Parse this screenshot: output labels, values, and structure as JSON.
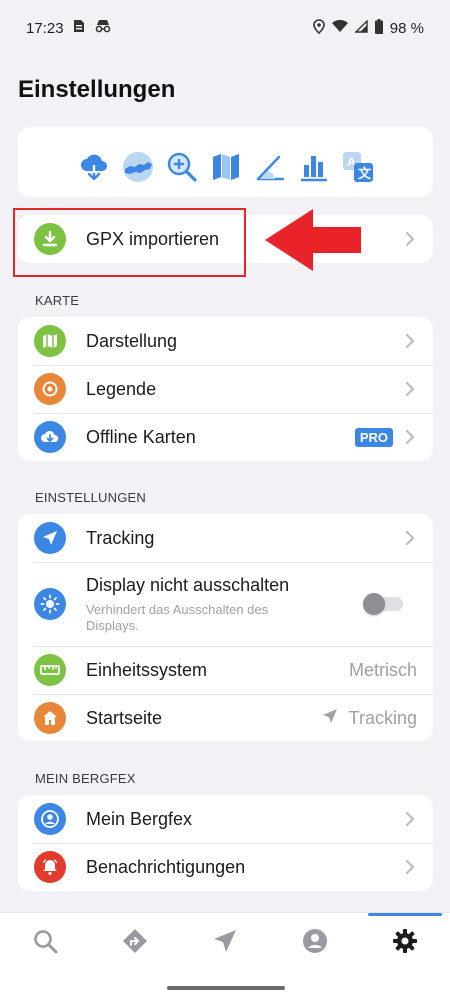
{
  "status_bar": {
    "time": "17:23",
    "battery": "98 %"
  },
  "page": {
    "title": "Einstellungen"
  },
  "feature_icons": [
    "cloud-download-icon",
    "austria-map-icon",
    "zoom-map-icon",
    "map-icon",
    "elevation-icon",
    "chart-icon",
    "translate-icon"
  ],
  "gpx_import": {
    "label": "GPX importieren"
  },
  "karte": {
    "header": "KARTE",
    "items": [
      {
        "label": "Darstellung"
      },
      {
        "label": "Legende"
      },
      {
        "label": "Offline Karten",
        "badge": "PRO"
      }
    ]
  },
  "einstellungen": {
    "header": "EINSTELLUNGEN",
    "tracking": {
      "label": "Tracking"
    },
    "display": {
      "label": "Display nicht ausschalten",
      "sublabel": "Verhindert das Ausschalten des Displays.",
      "enabled": false
    },
    "einheit": {
      "label": "Einheitssystem",
      "value": "Metrisch"
    },
    "startseite": {
      "label": "Startseite",
      "value": "Tracking"
    }
  },
  "mein_bergfex": {
    "header": "MEIN BERGFEX",
    "items": [
      {
        "label": "Mein Bergfex"
      },
      {
        "label": "Benachrichtigungen"
      }
    ]
  },
  "bottom_nav": {
    "tabs": [
      "search",
      "routes",
      "navigate",
      "profile",
      "settings"
    ],
    "active": "settings"
  },
  "colors": {
    "green": "#7dc242",
    "orange": "#e8863a",
    "blue": "#3c87e4",
    "red": "#e23a2d",
    "highlight": "#e02a2a"
  }
}
